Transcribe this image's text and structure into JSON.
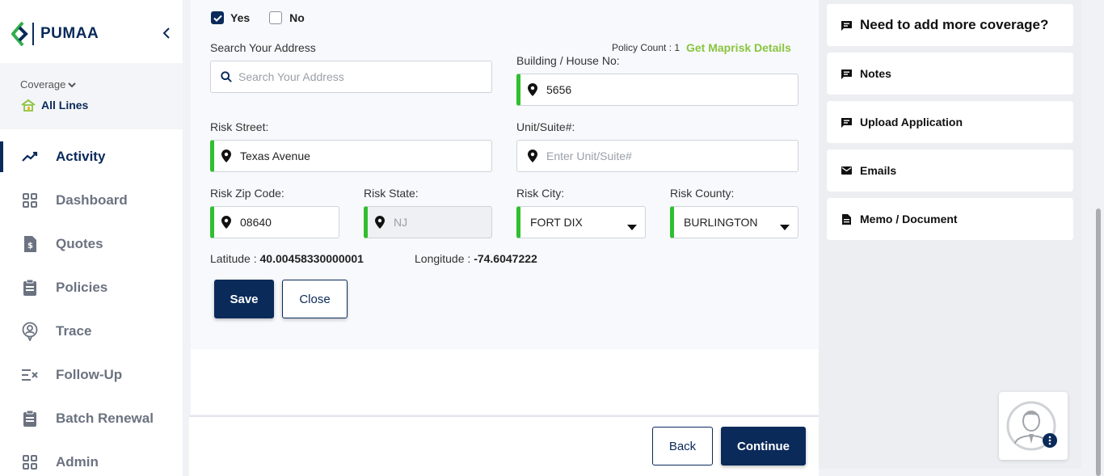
{
  "brand": {
    "name": "PUMAA"
  },
  "coverage": {
    "label": "Coverage",
    "value": "All Lines"
  },
  "nav": [
    {
      "label": "Activity",
      "icon": "trend-icon",
      "active": true
    },
    {
      "label": "Dashboard",
      "icon": "grid-icon"
    },
    {
      "label": "Quotes",
      "icon": "dollar-doc-icon"
    },
    {
      "label": "Policies",
      "icon": "clipboard-icon"
    },
    {
      "label": "Trace",
      "icon": "trace-icon"
    },
    {
      "label": "Follow-Up",
      "icon": "follow-up-icon"
    },
    {
      "label": "Batch Renewal",
      "icon": "clipboard-icon"
    },
    {
      "label": "Admin",
      "icon": "grid-icon"
    }
  ],
  "form": {
    "yes_label": "Yes",
    "no_label": "No",
    "search_label": "Search Your Address",
    "search_placeholder": "Search Your Address",
    "policy_count": "Policy Count : 1",
    "maprisk_link": "Get Maprisk Details",
    "building_label": "Building / House No:",
    "building_value": "5656",
    "street_label": "Risk Street:",
    "street_value": "Texas Avenue",
    "unit_label": "Unit/Suite#:",
    "unit_placeholder": "Enter Unit/Suite#",
    "zip_label": "Risk Zip Code:",
    "zip_value": "08640",
    "state_label": "Risk State:",
    "state_value": "NJ",
    "city_label": "Risk City:",
    "city_value": "FORT DIX",
    "county_label": "Risk County:",
    "county_value": "BURLINGTON",
    "latitude_label": "Latitude :",
    "latitude_value": "40.00458330000001",
    "longitude_label": "Longitude :",
    "longitude_value": "-74.6047222",
    "save_label": "Save",
    "close_label": "Close"
  },
  "footer": {
    "back_label": "Back",
    "continue_label": "Continue"
  },
  "right_panel": [
    {
      "label": "Need to add more coverage?",
      "icon": "chat-icon"
    },
    {
      "label": "Notes",
      "icon": "chat-icon"
    },
    {
      "label": "Upload Application",
      "icon": "chat-icon"
    },
    {
      "label": "Emails",
      "icon": "mail-icon"
    },
    {
      "label": "Memo / Document",
      "icon": "document-icon"
    }
  ],
  "colors": {
    "navy": "#0a2a5a",
    "green": "#2fbf2f",
    "link_green": "#8ac440"
  }
}
